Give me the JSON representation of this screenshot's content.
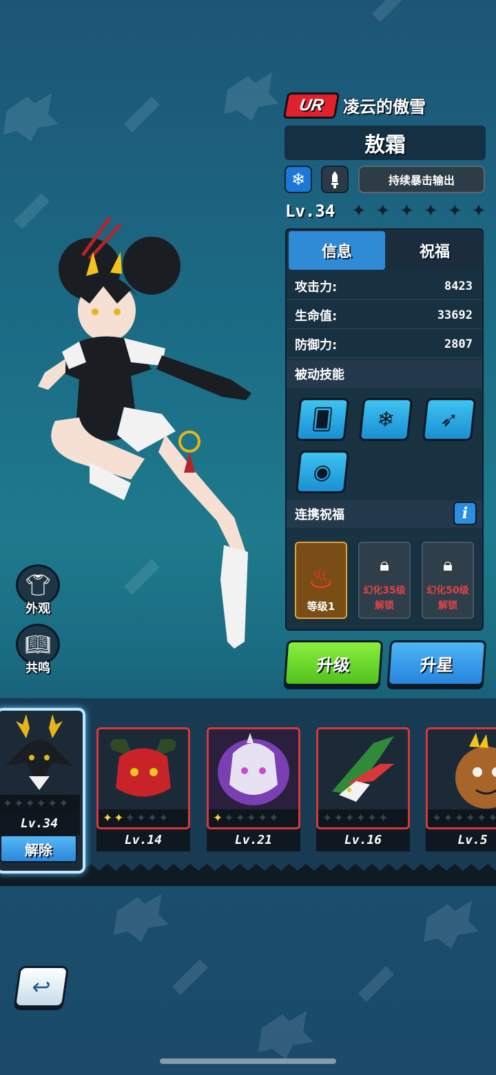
{
  "hero": {
    "rarity": "UR",
    "title": "凌云的傲雪",
    "name": "敖霜",
    "element_icon": "snowflake-icon",
    "weapon_icon": "dagger-icon",
    "role": "持续暴击输出",
    "level": "Lv.34",
    "stars_total": 6,
    "stars_lit": 0
  },
  "tabs": {
    "info": "信息",
    "bless": "祝福"
  },
  "stats": [
    {
      "label": "攻击力:",
      "value": "8423"
    },
    {
      "label": "生命值:",
      "value": "33692"
    },
    {
      "label": "防御力:",
      "value": "2807"
    }
  ],
  "passive_skills": {
    "header": "被动技能",
    "icons": [
      "card-snow-icon",
      "snowflakes-icon",
      "claw-slash-icon",
      "dragon-crest-icon"
    ]
  },
  "combo_bless": {
    "header": "连携祝福",
    "info_icon": "i",
    "slots": [
      {
        "level_label": "等级1"
      },
      {
        "line1": "幻化35级",
        "line2": "解锁"
      },
      {
        "line1": "幻化50级",
        "line2": "解锁"
      }
    ]
  },
  "buttons": {
    "upgrade": "升级",
    "star_up": "升星"
  },
  "side_buttons": {
    "appearance": "外观",
    "resonance": "共鸣"
  },
  "pets": [
    {
      "level": "Lv.34",
      "stars_lit": 0,
      "action": "解除",
      "name_icon": "white-stag-icon"
    },
    {
      "level": "Lv.14",
      "stars_lit": 2,
      "name_icon": "red-demon-icon"
    },
    {
      "level": "Lv.21",
      "stars_lit": 1,
      "name_icon": "purple-ghost-icon"
    },
    {
      "level": "Lv.16",
      "stars_lit": 0,
      "name_icon": "green-bird-icon"
    },
    {
      "level": "Lv.5",
      "stars_lit": 0,
      "name_icon": "orange-beast-icon"
    }
  ],
  "colors": {
    "accent_blue": "#2f8bd6",
    "upgrade_green": "#6fdc2c",
    "rarity_red": "#e0212c",
    "lock_text_red": "#e04444"
  }
}
